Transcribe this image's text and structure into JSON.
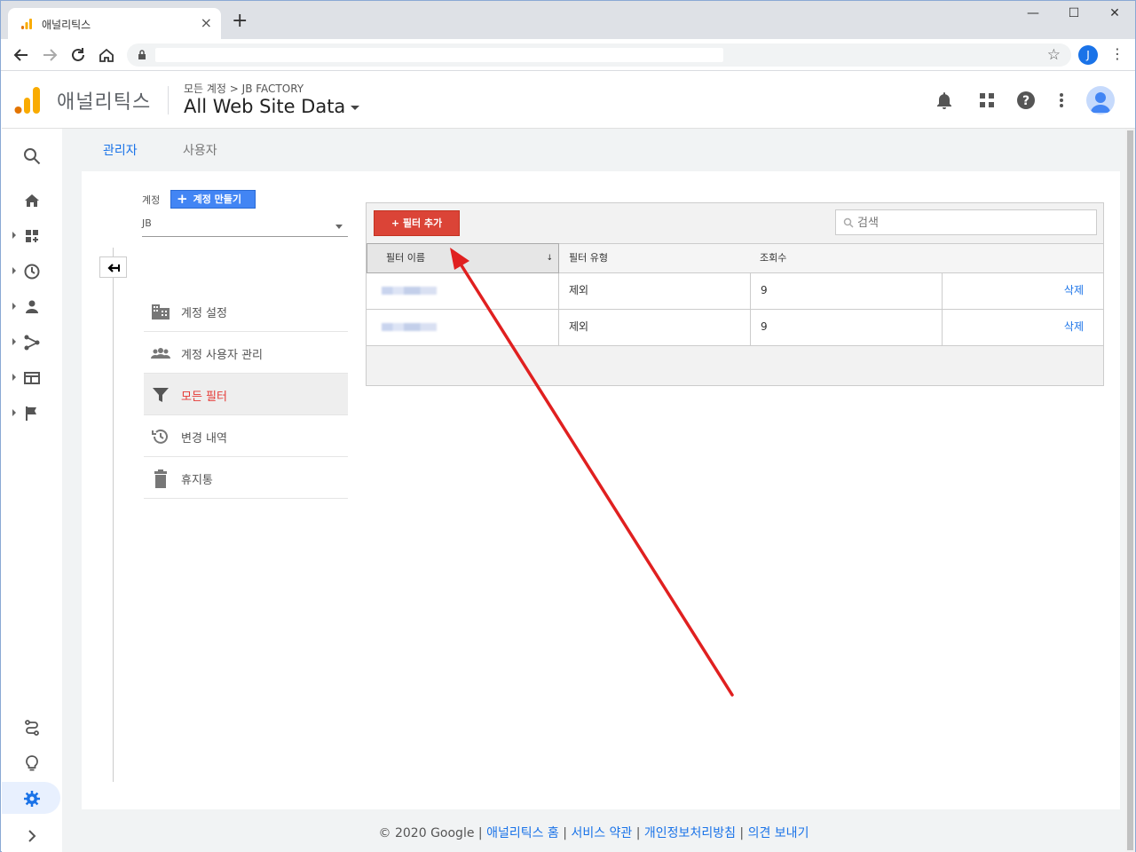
{
  "browser": {
    "tab_title": "애널리틱스",
    "tab_close": "×",
    "new_tab": "+",
    "profile_initial": "J",
    "win_minimize": "—",
    "win_maximize": "☐",
    "win_close": "✕"
  },
  "header": {
    "product": "애널리틱스",
    "breadcrumb": "모든 계정 > JB FACTORY",
    "property": "All Web Site Data"
  },
  "tabs": [
    {
      "label": "관리자"
    },
    {
      "label": "사용자"
    }
  ],
  "account": {
    "label": "계정",
    "create_button": "계정 만들기",
    "selected": "JB"
  },
  "menu": [
    {
      "label": "계정 설정",
      "icon": "building-icon"
    },
    {
      "label": "계정 사용자 관리",
      "icon": "people-icon"
    },
    {
      "label": "모든 필터",
      "icon": "filter-icon",
      "active": true
    },
    {
      "label": "변경 내역",
      "icon": "history-icon"
    },
    {
      "label": "휴지통",
      "icon": "trash-icon"
    }
  ],
  "filters": {
    "add_button": "+ 필터 추가",
    "search_placeholder": "검색",
    "columns": [
      "필터 이름",
      "필터 유형",
      "조회수",
      ""
    ],
    "sort_arrow": "↓",
    "rows": [
      {
        "type": "제외",
        "views": "9",
        "action": "삭제"
      },
      {
        "type": "제외",
        "views": "9",
        "action": "삭제"
      }
    ]
  },
  "footer": {
    "copyright": "© 2020 Google",
    "sep": " | ",
    "links": [
      "애널리틱스 홈",
      "서비스 약관",
      "개인정보처리방침",
      "의견 보내기"
    ]
  },
  "colors": {
    "accent": "#1a73e8",
    "add_button": "#db4437",
    "create_button": "#4285f4",
    "arrow": "#e02020"
  }
}
